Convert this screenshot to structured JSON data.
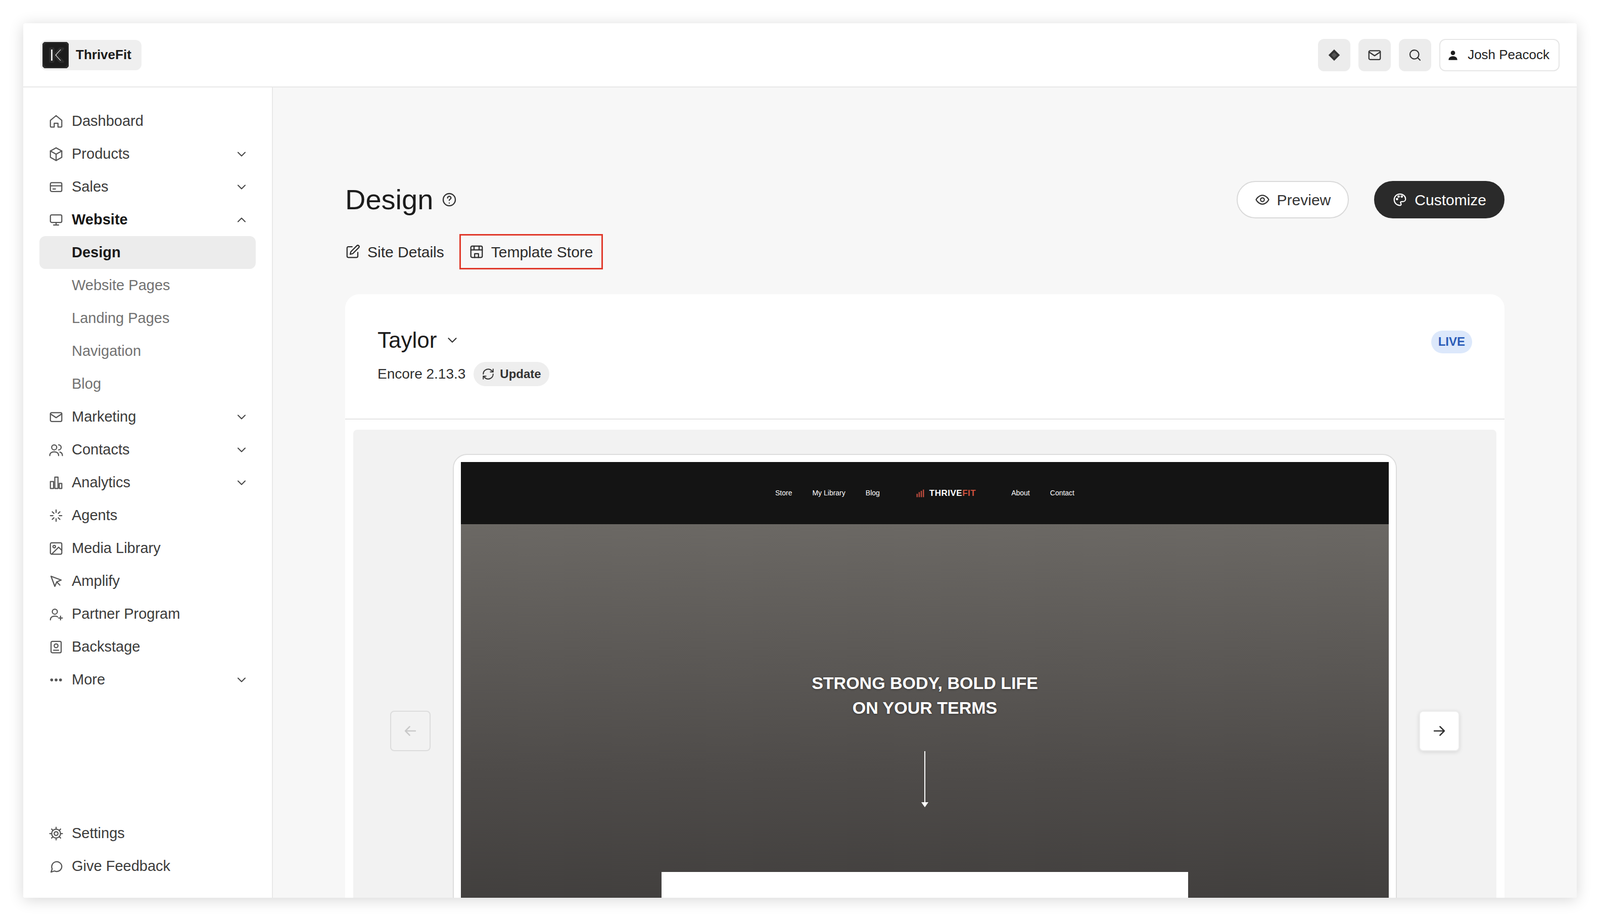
{
  "app": {
    "name": "ThriveFit"
  },
  "header": {
    "user": "Josh Peacock"
  },
  "sidebar": {
    "items": [
      {
        "label": "Dashboard",
        "kind": "link",
        "selected": false
      },
      {
        "label": "Products",
        "kind": "group",
        "expanded": false,
        "selected": false
      },
      {
        "label": "Sales",
        "kind": "group",
        "expanded": false,
        "selected": false
      },
      {
        "label": "Website",
        "kind": "group",
        "expanded": true,
        "selected": true,
        "children": [
          {
            "label": "Design",
            "selected": true
          },
          {
            "label": "Website Pages",
            "selected": false
          },
          {
            "label": "Landing Pages",
            "selected": false
          },
          {
            "label": "Navigation",
            "selected": false
          },
          {
            "label": "Blog",
            "selected": false
          }
        ]
      },
      {
        "label": "Marketing",
        "kind": "group",
        "expanded": false,
        "selected": false
      },
      {
        "label": "Contacts",
        "kind": "group",
        "expanded": false,
        "selected": false
      },
      {
        "label": "Analytics",
        "kind": "group",
        "expanded": false,
        "selected": false
      },
      {
        "label": "Agents",
        "kind": "link",
        "selected": false
      },
      {
        "label": "Media Library",
        "kind": "link",
        "selected": false
      },
      {
        "label": "Amplify",
        "kind": "link",
        "selected": false
      },
      {
        "label": "Partner Program",
        "kind": "link",
        "selected": false
      },
      {
        "label": "Backstage",
        "kind": "link",
        "selected": false
      },
      {
        "label": "More",
        "kind": "group",
        "expanded": false,
        "selected": false
      }
    ],
    "footer": [
      {
        "label": "Settings"
      },
      {
        "label": "Give Feedback"
      }
    ]
  },
  "page": {
    "title": "Design",
    "links": [
      {
        "label": "Site Details",
        "highlighted": false
      },
      {
        "label": "Template Store",
        "highlighted": true
      }
    ],
    "actions": [
      {
        "label": "Preview",
        "kind": "outline"
      },
      {
        "label": "Customize",
        "kind": "dark"
      }
    ]
  },
  "theme": {
    "name": "Taylor",
    "version": "Encore 2.13.3",
    "update": "Update",
    "status": "LIVE"
  },
  "preview": {
    "nav_left": [
      "Store",
      "My Library",
      "Blog"
    ],
    "brand": [
      {
        "text": "THRIVE",
        "color": "#ffffff"
      },
      {
        "text": "FIT",
        "color": "#d0523f"
      }
    ],
    "nav_right": [
      "About",
      "Contact"
    ],
    "headline": [
      "STRONG BODY, BOLD LIFE",
      "ON YOUR TERMS"
    ],
    "prev": {
      "disabled": true
    },
    "next": {
      "disabled": false
    }
  }
}
